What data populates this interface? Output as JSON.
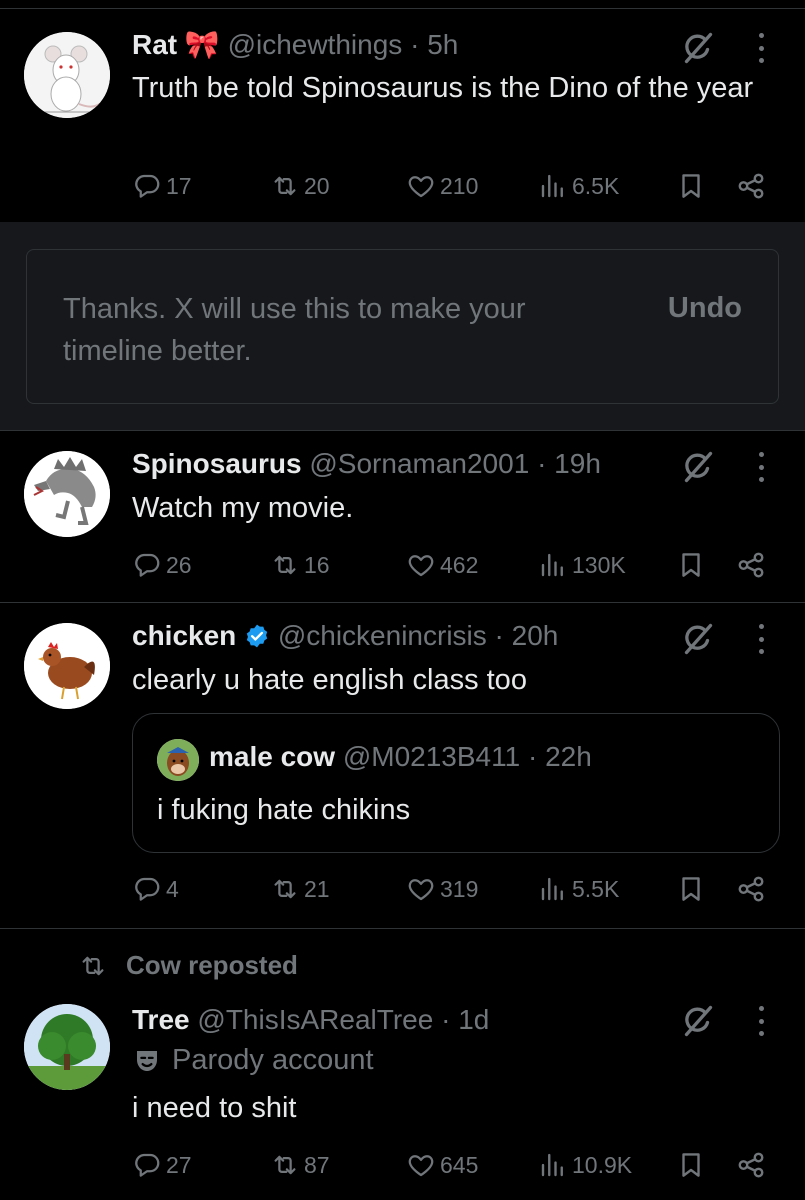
{
  "tweets": [
    {
      "name": "Rat",
      "emoji": "🎀",
      "handle": "@ichewthings",
      "dot": "·",
      "time": "5h",
      "text": "Truth be told Spinosaurus is the Dino of the year",
      "replies": "17",
      "reposts": "20",
      "likes": "210",
      "views": "6.5K"
    },
    {
      "name": "Spinosaurus",
      "handle": "@Sornaman2001",
      "dot": "·",
      "time": "19h",
      "text": "Watch my movie.",
      "replies": "26",
      "reposts": "16",
      "likes": "462",
      "views": "130K"
    },
    {
      "name": "chicken",
      "verified": true,
      "handle": "@chickenincrisis",
      "dot": "·",
      "time": "20h",
      "text": "clearly u hate english class too",
      "quote": {
        "name": "male cow",
        "handle": "@M0213B411",
        "dot": "·",
        "time": "22h",
        "text": "i fuking hate chikins"
      },
      "replies": "4",
      "reposts": "21",
      "likes": "319",
      "views": "5.5K"
    },
    {
      "repost_label": "Cow reposted",
      "name": "Tree",
      "handle": "@ThisIsARealTree",
      "dot": "·",
      "time": "1d",
      "parody_label": "Parody account",
      "text": "i need to shit",
      "replies": "27",
      "reposts": "87",
      "likes": "645",
      "views": "10.9K"
    }
  ],
  "notice": {
    "text": "Thanks. X will use this to make your timeline better.",
    "undo": "Undo"
  },
  "colors": {
    "background": "#000000",
    "text": "#e7e9ea",
    "muted": "#71767b",
    "verified": "#1d9bf0",
    "border": "#2f3336"
  }
}
